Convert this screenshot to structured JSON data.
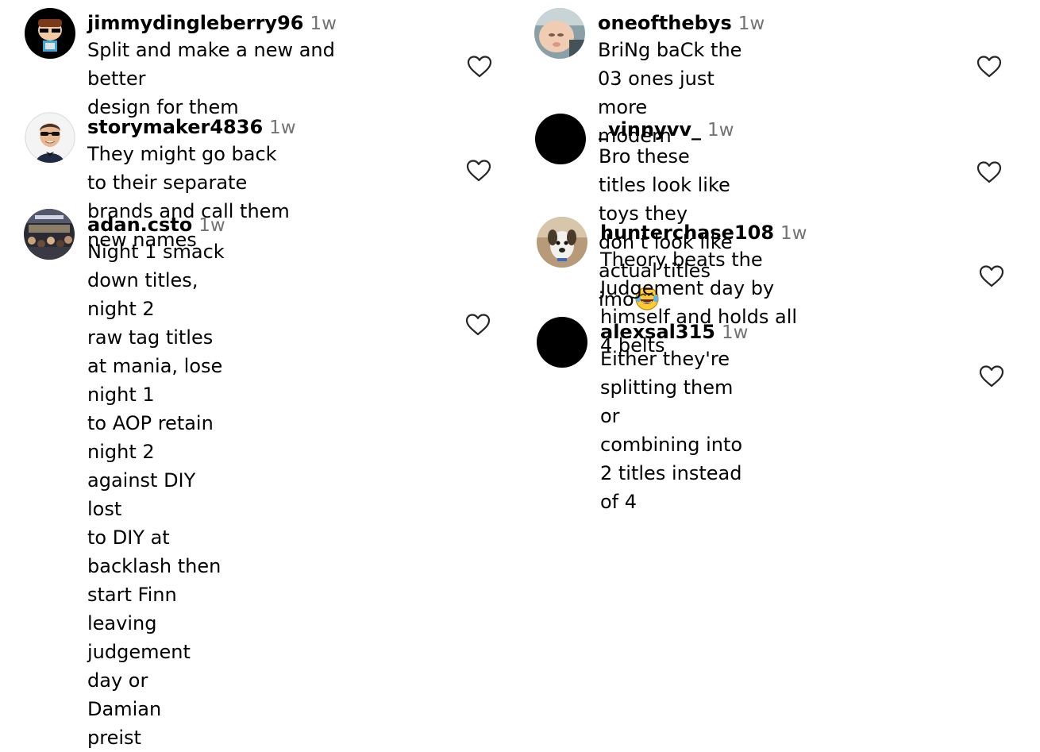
{
  "comments": [
    {
      "username": "jimmydingleberry96",
      "time": "1w",
      "text": "Split and make a new and better\ndesign for them",
      "avatar_icon": "cartoon-character-avatar"
    },
    {
      "username": "storymaker4836",
      "time": "1w",
      "text": "They might go back to their separate\nbrands and call them new names",
      "avatar_icon": "man-with-sunglasses-avatar"
    },
    {
      "username": "adan.csto",
      "time": "1w",
      "text": "Night 1 smack down titles, night 2\nraw tag titles at mania, lose night 1\nto AOP retain night 2 against DIY lost\nto DIY at backlash then start Finn\nleaving judgement day or Damian\npreist",
      "avatar_icon": "arena-crowd-avatar"
    },
    {
      "username": "oneofthebys",
      "time": "1w",
      "text": "BriNg baCk the 03 ones just more\nmodern",
      "avatar_icon": "baby-photo-avatar"
    },
    {
      "username": "_vinnyvv_",
      "time": "1w",
      "text": "Bro these titles look like toys they\ndon’t look like actual titles imo",
      "emoji": "😂",
      "avatar_icon": "black-circle-avatar"
    },
    {
      "username": "hunterchase108",
      "time": "1w",
      "text": "Theory beats the Judgement day by\nhimself and holds all 4 belts",
      "avatar_icon": "dog-photo-avatar"
    },
    {
      "username": "alexsal315",
      "time": "1w",
      "text": "Either they're splitting them or\ncombining into 2 titles instead of 4",
      "avatar_icon": "black-circle-avatar"
    }
  ],
  "colors": {
    "timestamp": "#737373",
    "text": "#000000",
    "heart_stroke": "#262626"
  },
  "like_icon": "heart-outline-icon"
}
